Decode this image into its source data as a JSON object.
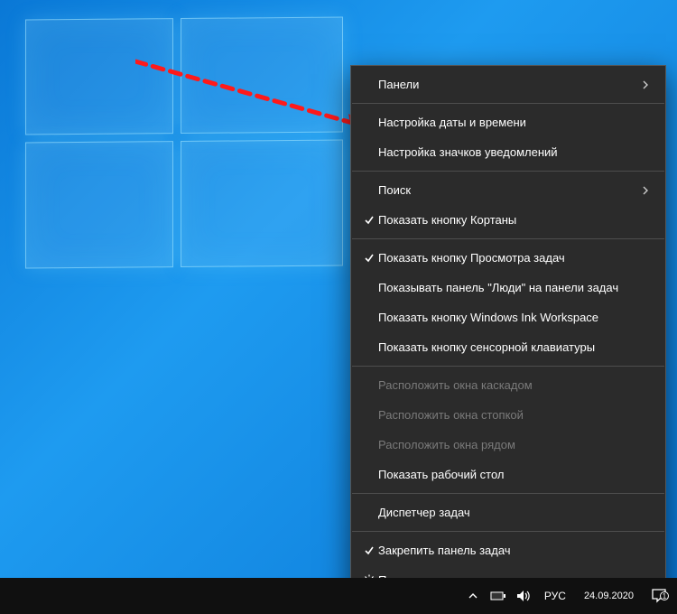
{
  "menu": {
    "items": [
      {
        "label": "Панели",
        "hasSubmenu": true
      },
      {
        "sep": true
      },
      {
        "label": "Настройка даты и времени",
        "highlighted": true
      },
      {
        "label": "Настройка значков уведомлений"
      },
      {
        "sep": true
      },
      {
        "label": "Поиск",
        "hasSubmenu": true
      },
      {
        "label": "Показать кнопку Кортаны",
        "checked": true
      },
      {
        "sep": true
      },
      {
        "label": "Показать кнопку Просмотра задач",
        "checked": true
      },
      {
        "label": "Показывать панель \"Люди\" на панели задач"
      },
      {
        "label": "Показать кнопку Windows Ink Workspace"
      },
      {
        "label": "Показать кнопку сенсорной клавиатуры"
      },
      {
        "sep": true
      },
      {
        "label": "Расположить окна каскадом",
        "disabled": true
      },
      {
        "label": "Расположить окна стопкой",
        "disabled": true
      },
      {
        "label": "Расположить окна рядом",
        "disabled": true
      },
      {
        "label": "Показать рабочий стол"
      },
      {
        "sep": true
      },
      {
        "label": "Диспетчер задач"
      },
      {
        "sep": true
      },
      {
        "label": "Закрепить панель задач",
        "checked": true
      },
      {
        "label": "Параметры панели задач",
        "gear": true
      }
    ]
  },
  "taskbar": {
    "lang": "РУС",
    "date": "24.09.2020",
    "notif_count": "1"
  }
}
